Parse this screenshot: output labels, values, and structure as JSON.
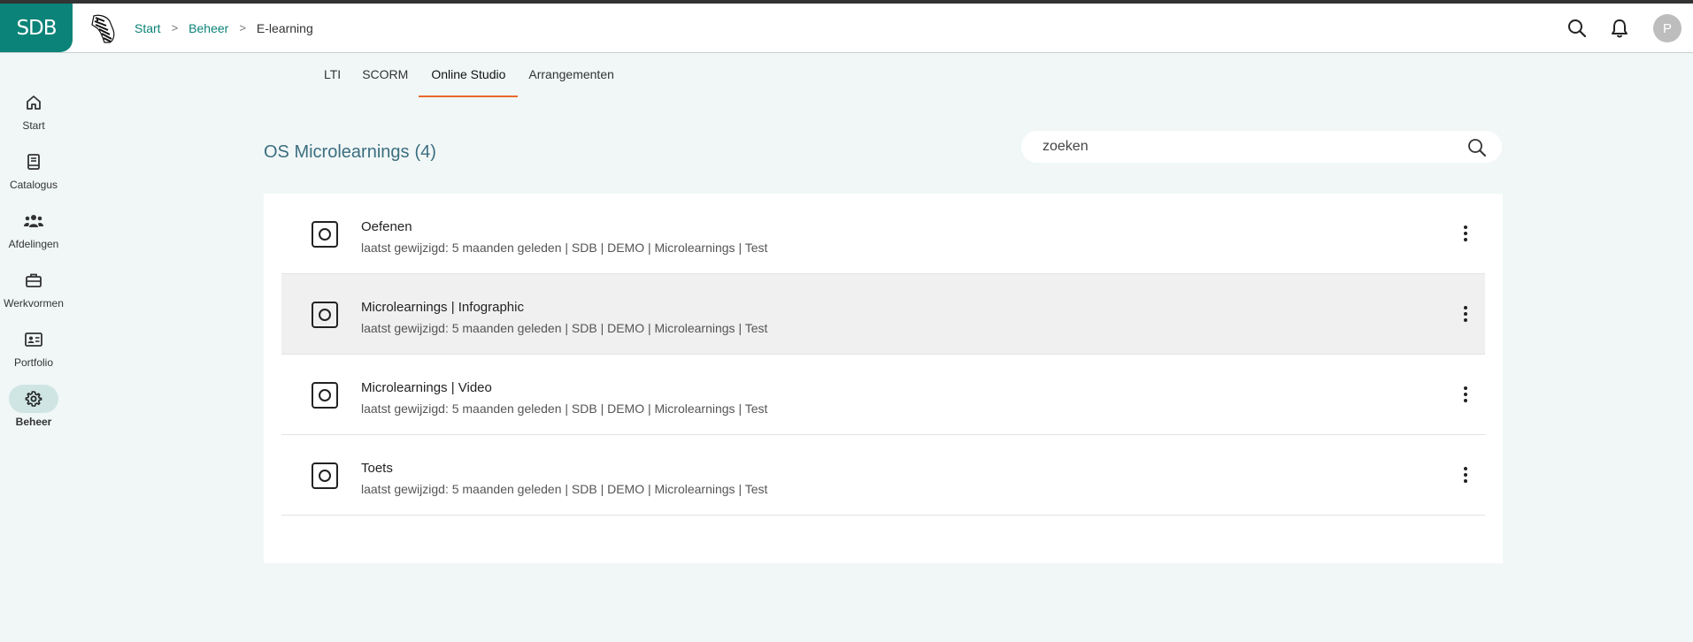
{
  "header": {
    "logo_text": "SDB",
    "breadcrumb": [
      {
        "label": "Start"
      },
      {
        "label": "Beheer"
      },
      {
        "label": "E-learning"
      }
    ],
    "separator": ">",
    "avatar_initial": "P",
    "icons": [
      "search-icon",
      "bell-icon"
    ]
  },
  "sidebar": {
    "items": [
      {
        "label": "Start",
        "icon": "home-icon"
      },
      {
        "label": "Catalogus",
        "icon": "book-icon"
      },
      {
        "label": "Afdelingen",
        "icon": "group-icon"
      },
      {
        "label": "Werkvormen",
        "icon": "briefcase-icon"
      },
      {
        "label": "Portfolio",
        "icon": "id-card-icon"
      },
      {
        "label": "Beheer",
        "icon": "gear-icon",
        "active": true
      }
    ]
  },
  "tabs": [
    {
      "label": "LTI"
    },
    {
      "label": "SCORM"
    },
    {
      "label": "Online Studio",
      "active": true
    },
    {
      "label": "Arrangementen"
    }
  ],
  "section": {
    "title": "OS Microlearnings",
    "count": "(4)"
  },
  "search": {
    "placeholder": "zoeken",
    "value": ""
  },
  "items": [
    {
      "title": "Oefenen",
      "meta": "laatst gewijzigd: 5 maanden geleden | SDB | DEMO | Microlearnings | Test"
    },
    {
      "title": "Microlearnings | Infographic",
      "meta": "laatst gewijzigd: 5 maanden geleden | SDB | DEMO | Microlearnings | Test"
    },
    {
      "title": "Microlearnings | Video",
      "meta": "laatst gewijzigd: 5 maanden geleden | SDB | DEMO | Microlearnings | Test"
    },
    {
      "title": "Toets",
      "meta": "laatst gewijzigd: 5 maanden geleden | SDB | DEMO | Microlearnings | Test"
    }
  ],
  "colors": {
    "brand": "#0b8378",
    "accent_tab": "#e86a2a",
    "title": "#3c6e80",
    "background": "#f1f7f7"
  }
}
